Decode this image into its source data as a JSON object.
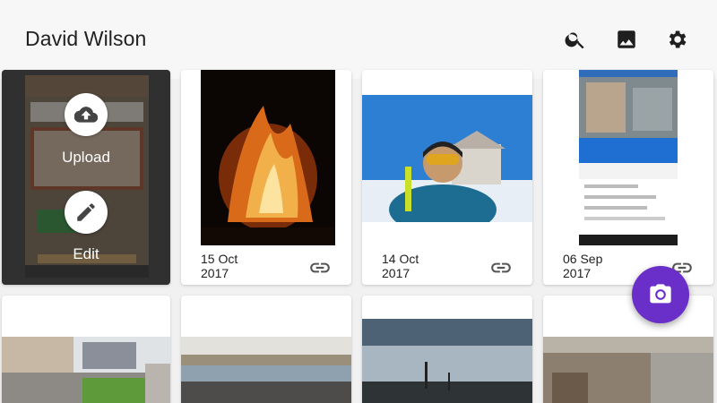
{
  "app_bar": {
    "title": "David Wilson",
    "icons": [
      "search-icon",
      "gallery-icon",
      "settings-icon"
    ]
  },
  "selected_card": {
    "upload_label": "Upload",
    "edit_label": "Edit"
  },
  "cards": [
    {
      "date": "15 Oct\n2017"
    },
    {
      "date": "14 Oct\n2017"
    },
    {
      "date": "06 Sep\n2017"
    }
  ],
  "fab": {
    "icon": "camera-icon"
  },
  "colors": {
    "accent": "#6a2fc8",
    "background": "#f1f1f1",
    "card": "#ffffff"
  }
}
